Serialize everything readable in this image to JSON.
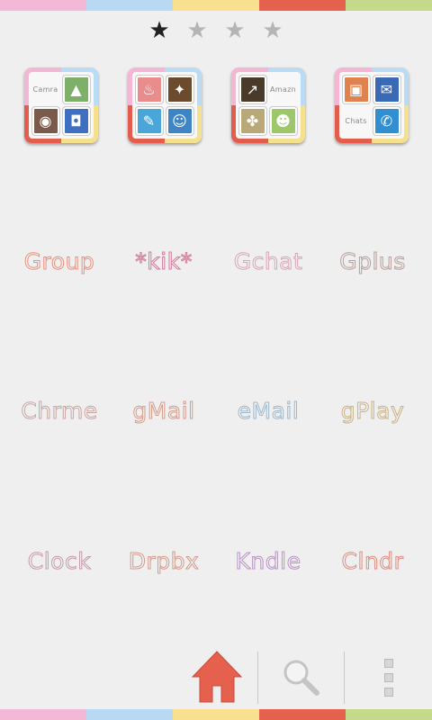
{
  "stripe_colors": [
    "#f3b8d5",
    "#b7daf2",
    "#f7e08f",
    "#e5604d",
    "#c4d98a"
  ],
  "pager": {
    "pages": [
      {
        "icon": "star-icon",
        "state": "active",
        "glyph": "★",
        "color": "#222222"
      },
      {
        "icon": "star-icon",
        "state": "inactive",
        "glyph": "★",
        "color": "#b5b5b5"
      },
      {
        "icon": "star-icon",
        "state": "inactive",
        "glyph": "★",
        "color": "#b5b5b5"
      },
      {
        "icon": "star-icon",
        "state": "inactive",
        "glyph": "★",
        "color": "#b5b5b5"
      }
    ]
  },
  "folders": [
    {
      "cells": [
        {
          "type": "label",
          "text": "Camra"
        },
        {
          "type": "icon",
          "icon": "gallery-icon",
          "glyph": "▲",
          "bg": "#7fb06a"
        },
        {
          "type": "icon",
          "icon": "instagram-icon",
          "glyph": "◉",
          "bg": "#7a5a4a"
        },
        {
          "type": "icon",
          "icon": "camera-icon",
          "glyph": "◘",
          "bg": "#3f6fc0"
        }
      ]
    },
    {
      "cells": [
        {
          "type": "icon",
          "icon": "cake-icon",
          "glyph": "♨",
          "bg": "#e98c8c"
        },
        {
          "type": "icon",
          "icon": "game-icon",
          "glyph": "✦",
          "bg": "#6b4a2e"
        },
        {
          "type": "icon",
          "icon": "paint-icon",
          "glyph": "✎",
          "bg": "#4aa6d9"
        },
        {
          "type": "icon",
          "icon": "character-icon",
          "glyph": "☺",
          "bg": "#3d85c4"
        }
      ]
    },
    {
      "cells": [
        {
          "type": "icon",
          "icon": "chart-icon",
          "glyph": "↗",
          "bg": "#4a3a2a"
        },
        {
          "type": "label",
          "text": "Amazn"
        },
        {
          "type": "icon",
          "icon": "puzzle-icon",
          "glyph": "✤",
          "bg": "#b9a878"
        },
        {
          "type": "icon",
          "icon": "chat-bubble-icon",
          "glyph": "☻",
          "bg": "#9cc86a"
        }
      ]
    },
    {
      "cells": [
        {
          "type": "icon",
          "icon": "contacts-icon",
          "glyph": "▣",
          "bg": "#e0824e"
        },
        {
          "type": "icon",
          "icon": "messages-icon",
          "glyph": "✉",
          "bg": "#3a6ab6"
        },
        {
          "type": "label",
          "text": "Chats"
        },
        {
          "type": "icon",
          "icon": "phone-icon",
          "glyph": "✆",
          "bg": "#2f8fd1"
        }
      ]
    }
  ],
  "apps": [
    [
      {
        "label": "Group",
        "color": "#e6917d"
      },
      {
        "label": "*kik*",
        "color": "#d6799c"
      },
      {
        "label": "Gchat",
        "color": "#d8a5b6"
      },
      {
        "label": "Gplus",
        "color": "#b79f9a"
      }
    ],
    [
      {
        "label": "Chrme",
        "color": "#c9a6a3"
      },
      {
        "label": "gMail",
        "color": "#d59b8a"
      },
      {
        "label": "eMail",
        "color": "#9db7cc"
      },
      {
        "label": "gPlay",
        "color": "#c8b183"
      }
    ],
    [
      {
        "label": "Clock",
        "color": "#c69aa8"
      },
      {
        "label": "Drpbx",
        "color": "#d39a8a"
      },
      {
        "label": "Kndle",
        "color": "#b893c4"
      },
      {
        "label": "Clndr",
        "color": "#d98e83"
      }
    ]
  ],
  "dock": {
    "home_icon": "home-icon",
    "home_color": "#e5604d",
    "search_icon": "search-icon",
    "menu_icon": "menu-icon"
  }
}
